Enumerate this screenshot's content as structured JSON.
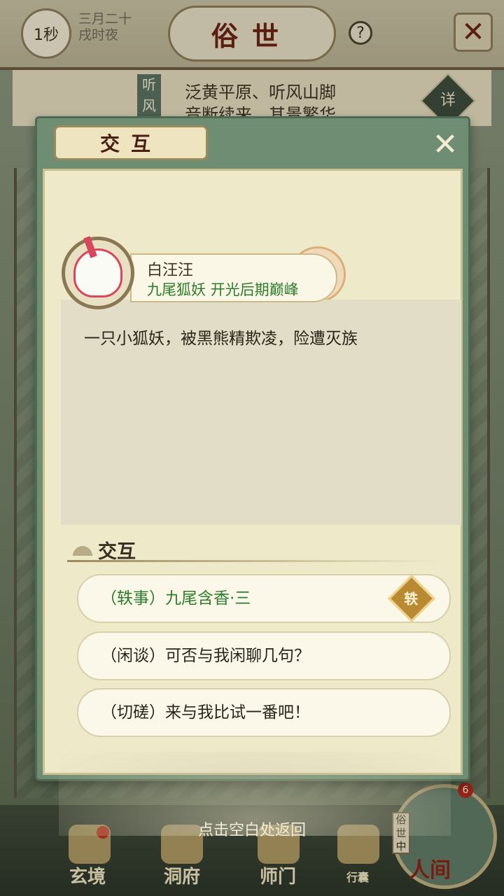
{
  "topbar": {
    "speed": "1秒",
    "date_line1": "三月二十",
    "date_line2": "戌时夜",
    "title": "俗世",
    "help": "?",
    "close": "✕"
  },
  "location": {
    "tag": "听风",
    "line1": "泛黄平原、听风山脚",
    "line2": "音断续来，其景繁华",
    "detail": "详"
  },
  "dialog": {
    "title": "交互",
    "close": "✕",
    "npc": {
      "name": "白汪汪",
      "subtitle": "九尾狐妖 开光后期巅峰",
      "description": "一只小狐妖，被黑熊精欺凌，险遭灭族"
    },
    "section_title": "交互",
    "options": [
      {
        "label": "（轶事）九尾含香·三",
        "tag": "轶"
      },
      {
        "label": "（闲谈）可否与我闲聊几句？"
      },
      {
        "label": "（切磋）来与我比试一番吧！"
      }
    ]
  },
  "hint": "点击空白处返回",
  "bottom_nav": {
    "items": [
      "玄境",
      "洞府",
      "师门",
      "行囊"
    ],
    "renjian": "人间",
    "suxz": "俗世中",
    "badge": "6"
  },
  "colors": {
    "accent_green": "#2b7d2b",
    "title_red": "#6b1f12",
    "dialog_frame": "#6f8d72"
  }
}
